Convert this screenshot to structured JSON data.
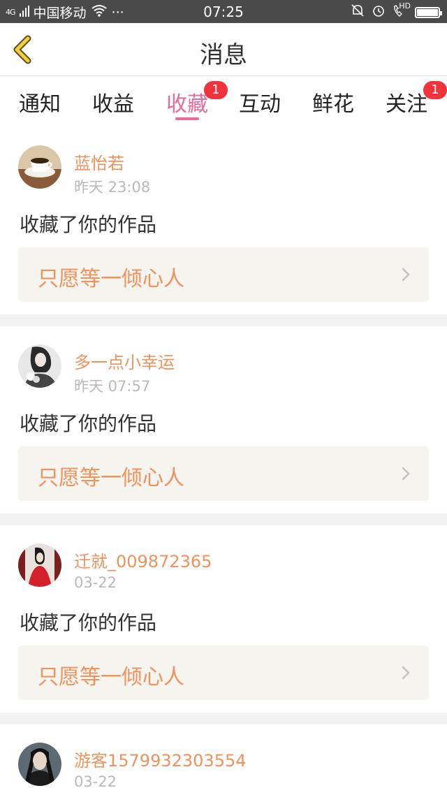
{
  "status_bar": {
    "signal": "4G",
    "carrier": "中国移动",
    "more": "···",
    "time": "07:25",
    "hd": "HD",
    "battery_level": 1.0
  },
  "header": {
    "title": "消息"
  },
  "tabs": [
    {
      "label": "通知",
      "active": false,
      "badge": ""
    },
    {
      "label": "收益",
      "active": false,
      "badge": ""
    },
    {
      "label": "收藏",
      "active": true,
      "badge": "1"
    },
    {
      "label": "互动",
      "active": false,
      "badge": ""
    },
    {
      "label": "鲜花",
      "active": false,
      "badge": ""
    },
    {
      "label": "关注",
      "active": false,
      "badge": "1"
    }
  ],
  "feed": [
    {
      "name": "蓝怡若",
      "time": "昨天 23:08",
      "action": "收藏了你的作品",
      "work": "只愿等一倾心人",
      "avatar": "coffee-cup-avatar"
    },
    {
      "name": "多一点小幸运",
      "time": "昨天 07:57",
      "action": "收藏了你的作品",
      "work": "只愿等一倾心人",
      "avatar": "girl-flowers-avatar"
    },
    {
      "name": "迁就_009872365",
      "time": "03-22",
      "action": "收藏了你的作品",
      "work": "只愿等一倾心人",
      "avatar": "red-dress-avatar"
    },
    {
      "name": "游客1579932303554",
      "time": "03-22",
      "action": "",
      "work": "",
      "avatar": "man-portrait-avatar"
    }
  ],
  "colors": {
    "accent_pink": "#e8699a",
    "name_orange": "#f0925c",
    "badge_red": "#f1333b",
    "back_yellow": "#f2cf3c"
  }
}
